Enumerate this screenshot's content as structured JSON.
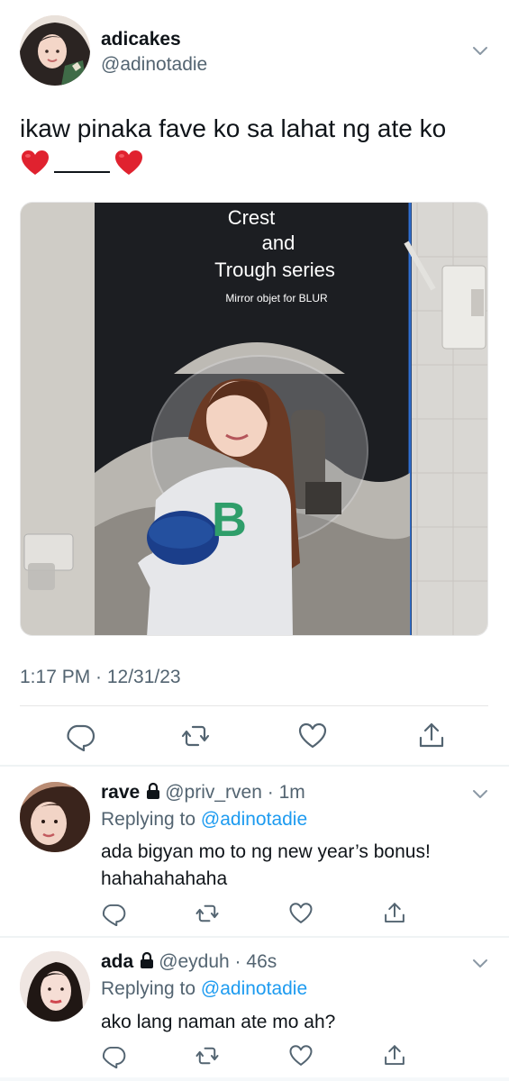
{
  "main_tweet": {
    "display_name": "adicakes",
    "handle": "@adinotadie",
    "text_line1": "ikaw pinaka fave ko sa lahat ng ate ko",
    "photo": {
      "poster_line1": "Crest",
      "poster_line2": "and",
      "poster_line3": "Trough series",
      "poster_line4": "Mirror objet for BLUR",
      "sweater_letter": "B"
    },
    "timestamp": "1:17 PM · 12/31/23"
  },
  "replies": [
    {
      "display_name": "rave",
      "handle_time": "@priv_rven · 1m",
      "replying_prefix": "Replying to",
      "replying_to": "@adinotadie",
      "text": "ada bigyan mo to ng new year’s bonus! hahahahahaha"
    },
    {
      "display_name": "ada",
      "handle_time": "@eyduh · 46s",
      "replying_prefix": "Replying to",
      "replying_to": "@adinotadie",
      "text": "ako lang naman ate mo ah?"
    }
  ],
  "icons": [
    "chevron-down-icon",
    "reply-icon",
    "retweet-icon",
    "like-icon",
    "share-icon",
    "lock-icon",
    "heart-emoji-icon"
  ],
  "colors": {
    "text": "#0f1419",
    "secondary": "#536471",
    "link": "#1d9bf0",
    "divider": "#e6e6e6"
  }
}
